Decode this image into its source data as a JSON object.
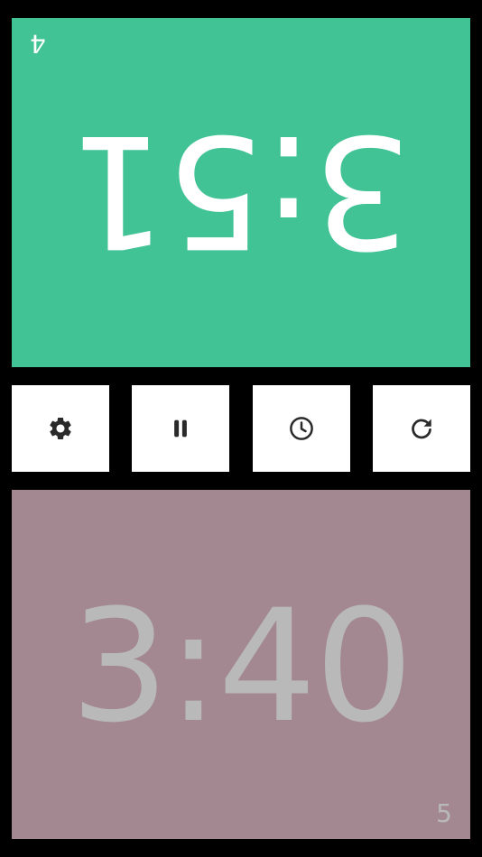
{
  "colors": {
    "background": "#000000",
    "active_player": "#41c396",
    "inactive_player": "#a38891",
    "button_bg": "#ffffff",
    "icon": "#2a2a2a",
    "active_text": "#ffffff",
    "inactive_text": "#b9b9b9"
  },
  "top_player": {
    "time": "3:51",
    "moves": "4",
    "state": "active"
  },
  "bottom_player": {
    "time": "3:40",
    "moves": "5",
    "state": "inactive"
  },
  "controls": [
    {
      "icon": "gear-icon"
    },
    {
      "icon": "pause-icon"
    },
    {
      "icon": "clock-icon"
    },
    {
      "icon": "reset-icon"
    }
  ]
}
